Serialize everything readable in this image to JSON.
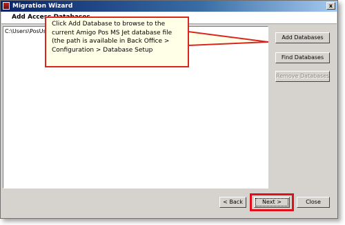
{
  "window": {
    "title": "Migration Wizard",
    "close_glyph": "x"
  },
  "header": {
    "heading": "Add Access Databases"
  },
  "database_list": {
    "items": [
      "C:\\Users\\PosUser"
    ]
  },
  "buttons": {
    "add_databases": "Add Databases",
    "find_databases": "Find Databases",
    "remove_databases": "Remove Databases",
    "back": "< Back",
    "next": "Next >",
    "close": "Close"
  },
  "callout": {
    "text": "Click Add Database to browse to the current Amigo Pos MS Jet database file (the path is available in Back Office > Configuration > Database Setup"
  },
  "colors": {
    "callout_border": "#d9251c",
    "next_highlight": "#e0101a"
  }
}
